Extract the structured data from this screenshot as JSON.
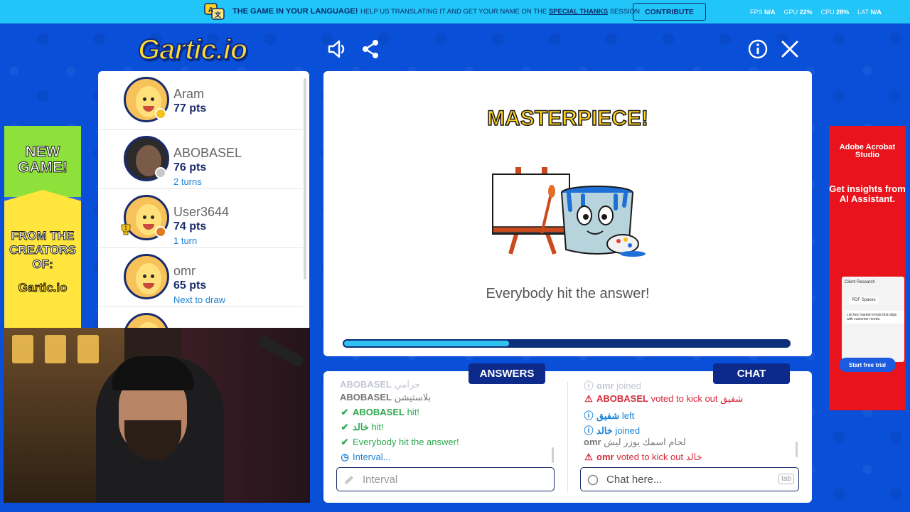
{
  "banner": {
    "title": "THE GAME IN YOUR LANGUAGE!",
    "text_prefix": "HELP US TRANSLATING IT AND GET YOUR NAME ON THE",
    "text_link": "SPECIAL THANKS",
    "text_suffix": "SESSION",
    "contribute_label": "CONTRIBUTE",
    "fps_label": "FPS",
    "fps_value": "N/A",
    "gpu_label": "GPU",
    "gpu_value": "22%",
    "cpu_label": "CPU",
    "cpu_value": "28%",
    "lat_label": "LAT",
    "lat_value": "N/A"
  },
  "logo": "Gartic.io",
  "players": [
    {
      "name": "Aram",
      "points": "77 pts",
      "sub": "",
      "status_color": "#f5c21a"
    },
    {
      "name": "ABOBASEL",
      "points": "76 pts",
      "sub": "2 turns",
      "status_color": "#c8c8c8"
    },
    {
      "name": "User3644",
      "points": "74 pts",
      "sub": "1 turn",
      "status_color": "#e07a1a",
      "trophy": "1"
    },
    {
      "name": "omr",
      "points": "65 pts",
      "sub": "Next to draw",
      "status_color": ""
    }
  ],
  "game": {
    "headline": "MASTERPIECE!",
    "message": "Everybody hit the answer!",
    "progress": 0.37
  },
  "answers": {
    "tab_label": "ANSWERS",
    "messages": [
      {
        "user": "ABOBASEL",
        "text": "حرامي",
        "type": "dim"
      },
      {
        "user": "ABOBASEL",
        "text": "بلاستيشن",
        "type": "plain"
      },
      {
        "user": "ABOBASEL",
        "text": "hit!",
        "type": "hit"
      },
      {
        "user": "خالد",
        "text": "hit!",
        "type": "hit"
      },
      {
        "user": "",
        "text": "Everybody hit the answer!",
        "type": "hit"
      },
      {
        "user": "",
        "text": "Interval...",
        "type": "info"
      }
    ],
    "input_placeholder": "Interval"
  },
  "chat": {
    "tab_label": "CHAT",
    "messages": [
      {
        "user": "omr",
        "text": "joined",
        "type": "dim"
      },
      {
        "user": "ABOBASEL",
        "text": "voted to kick out شفيق",
        "type": "warn"
      },
      {
        "user": "شفيق",
        "text": "left",
        "type": "info"
      },
      {
        "user": "خالد",
        "text": "joined",
        "type": "info"
      },
      {
        "user": "omr",
        "text": "لحام اسمك يوزر ليش",
        "type": "plain"
      },
      {
        "user": "omr",
        "text": "voted to kick out خالد",
        "type": "warn"
      }
    ],
    "input_placeholder": "Chat here...",
    "tab_key": "tab"
  },
  "ads": {
    "left_line1": "NEW GAME!",
    "left_line2": "FROM THE CREATORS OF:",
    "left_logo": "Gartic.io",
    "right_title": "Adobe Acrobat Studio",
    "right_headline": "Get insights from AI Assistant.",
    "right_cta": "Start free trial",
    "right_card_title": "Client Research",
    "right_card_chip": "PDF Spaces",
    "right_card_text": "List key market trends that align with customer needs."
  },
  "colors": {
    "accent_dark": "#0d2a8a",
    "progress": "#2fc2f0",
    "hit_green": "#2fa84f",
    "warn_red": "#d42a3a",
    "info_blue": "#1e84d6"
  }
}
